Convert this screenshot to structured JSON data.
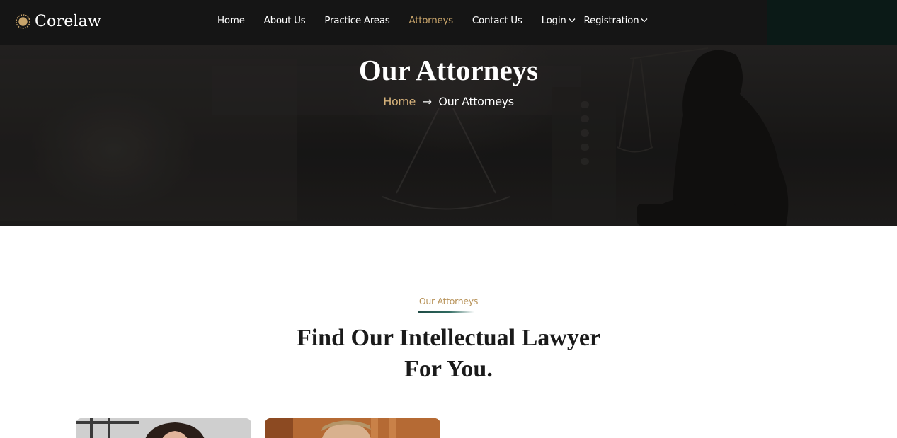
{
  "brand": {
    "name": "Corelaw",
    "accent": "#c9a56b"
  },
  "nav": {
    "items": [
      {
        "label": "Home",
        "active": false
      },
      {
        "label": "About Us",
        "active": false
      },
      {
        "label": "Practice Areas",
        "active": false
      },
      {
        "label": "Attorneys",
        "active": true
      },
      {
        "label": "Contact Us",
        "active": false
      }
    ],
    "login": "Login",
    "registration": "Registration"
  },
  "hero": {
    "title": "Our Attorneys",
    "breadcrumb": {
      "home": "Home",
      "separator": "→",
      "current": "Our Attorneys"
    }
  },
  "section": {
    "eyebrow": "Our Attorneys",
    "title_line1": "Find Our Intellectual Lawyer",
    "title_line2": "For You."
  },
  "cards": [
    {
      "icon": "attorney-photo"
    },
    {
      "icon": "attorney-photo"
    }
  ]
}
